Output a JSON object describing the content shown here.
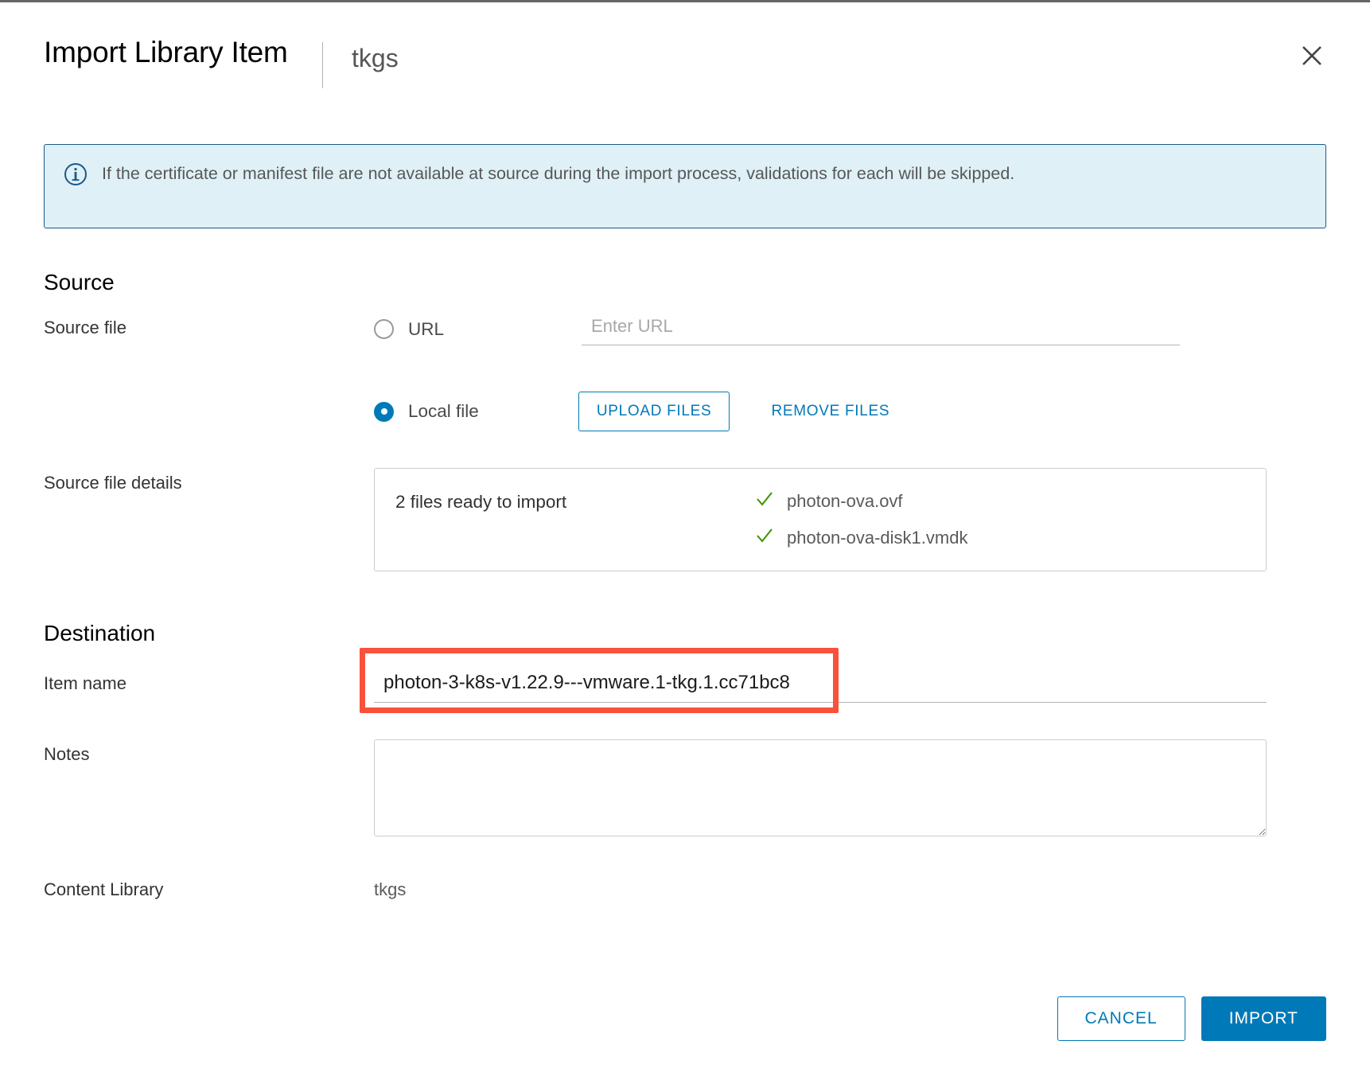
{
  "dialog": {
    "title": "Import Library Item",
    "subtitle": "tkgs",
    "close_icon": "close-icon"
  },
  "alert": {
    "icon": "info-circle-icon",
    "message": "If the certificate or manifest file are not available at source during the import process, validations for each will be skipped.",
    "border_color": "#1a5a87",
    "background_color": "#dff0f7"
  },
  "source": {
    "heading": "Source",
    "source_file_label": "Source file",
    "url_option_label": "URL",
    "url_option_selected": false,
    "url_input_value": "",
    "url_input_placeholder": "Enter URL",
    "local_file_option_label": "Local file",
    "local_file_option_selected": true,
    "upload_files_label": "UPLOAD FILES",
    "remove_files_label": "REMOVE FILES",
    "details_label": "Source file details",
    "files_summary": "2 files ready to import",
    "files": [
      {
        "name": "photon-ova.ovf",
        "status_icon": "check-icon",
        "status_color": "#3e9700"
      },
      {
        "name": "photon-ova-disk1.vmdk",
        "status_icon": "check-icon",
        "status_color": "#3e9700"
      }
    ]
  },
  "destination": {
    "heading": "Destination",
    "item_name_label": "Item name",
    "item_name_value": "photon-3-k8s-v1.22.9---vmware.1-tkg.1.cc71bc8",
    "item_name_highlight_color": "#f9513a",
    "notes_label": "Notes",
    "notes_value": "",
    "content_library_label": "Content Library",
    "content_library_value": "tkgs"
  },
  "footer": {
    "cancel_label": "CANCEL",
    "import_label": "IMPORT",
    "accent_color": "#0079b8"
  }
}
